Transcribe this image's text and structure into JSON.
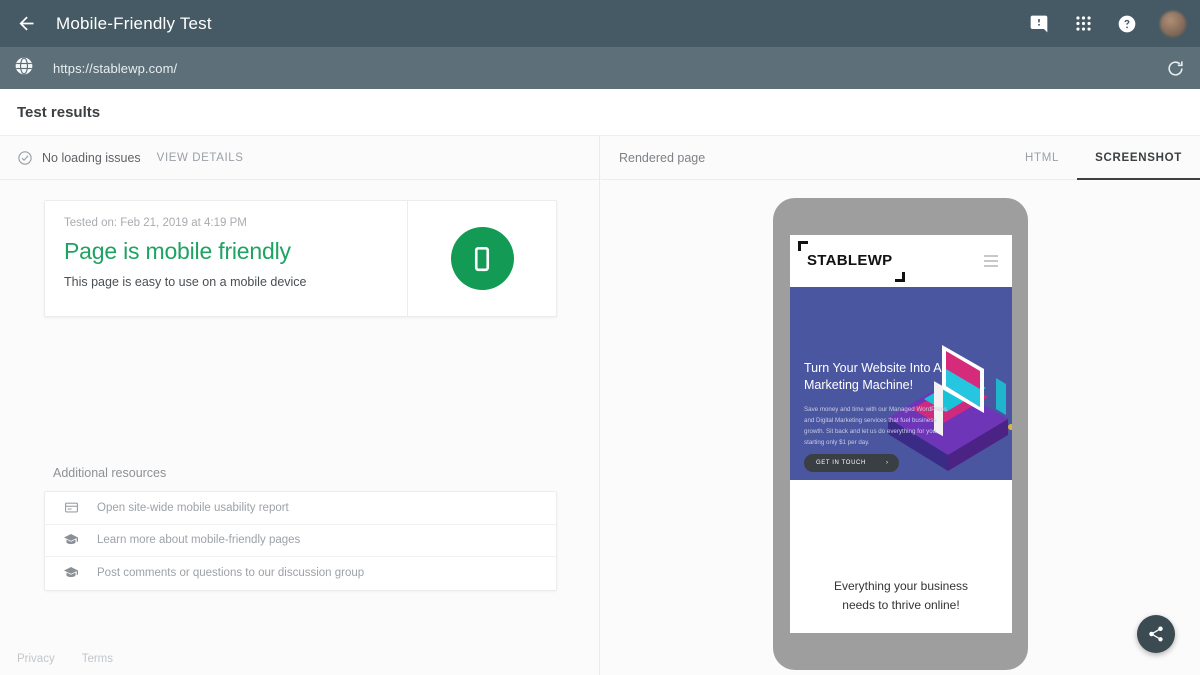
{
  "appbar": {
    "title": "Mobile-Friendly Test",
    "back_icon": "arrow-back-icon",
    "feedback_icon": "feedback-icon",
    "apps_icon": "apps-grid-icon",
    "help_icon": "help-circle-icon",
    "avatar_label": "account-avatar"
  },
  "urlbar": {
    "globe_icon": "globe-icon",
    "url": "https://stablewp.com/",
    "reload_icon": "reload-icon"
  },
  "results_header": {
    "title": "Test results"
  },
  "status": {
    "check_icon": "check-circle-icon",
    "text": "No loading issues",
    "view_details": "VIEW DETAILS"
  },
  "result_card": {
    "tested_on": "Tested on: Feb 21, 2019 at 4:19 PM",
    "verdict": "Page is mobile friendly",
    "subtitle": "This page is easy to use on a mobile device",
    "badge_icon": "mobile-phone-icon",
    "badge_color": "#139a54",
    "verdict_color": "#1ea362"
  },
  "additional_resources": {
    "title": "Additional resources",
    "items": [
      {
        "icon": "report-card-icon",
        "label": "Open site-wide mobile usability report"
      },
      {
        "icon": "school-cap-icon",
        "label": "Learn more about mobile-friendly pages"
      },
      {
        "icon": "school-cap-icon",
        "label": "Post comments or questions to our discussion group"
      }
    ]
  },
  "footer": {
    "privacy": "Privacy",
    "terms": "Terms"
  },
  "rendered_panel": {
    "title": "Rendered page",
    "tabs": [
      {
        "label": "HTML",
        "active": false
      },
      {
        "label": "SCREENSHOT",
        "active": true
      }
    ]
  },
  "phone_preview": {
    "logo": "STABLE",
    "logo_accent": "WP",
    "menu_icon": "hamburger-menu-icon",
    "hero_heading": "Turn Your Website Into A Marketing Machine!",
    "hero_body": "Save money and time with our Managed WordPress and Digital Marketing services that fuel business growth. Sit back and let us do everything for you, starting only $1 per day.",
    "cta_label": "GET IN TOUCH",
    "cta_arrow": "›",
    "bottom_line1": "Everything your business",
    "bottom_line2": "needs to thrive online!",
    "hero_bg": "#4a569f"
  },
  "fab": {
    "icon": "share-icon"
  }
}
